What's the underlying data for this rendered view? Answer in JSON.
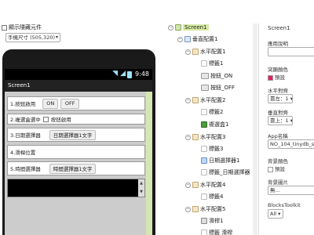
{
  "viewer": {
    "show_hidden_label": "顯示隱藏元件",
    "phone_size": "手機尺寸 (505,320)",
    "status_time": "9:48",
    "screen_title": "Screen1",
    "rows": [
      {
        "label": "1.按鈕啟用",
        "buttons": [
          "ON",
          "OFF"
        ]
      },
      {
        "label": "2.複選盒選中",
        "checkbox_label": "按鈕啟用"
      },
      {
        "label": "3.日期選擇器",
        "picker": "日期選擇器1文字"
      },
      {
        "label": "4.滑桿位置"
      },
      {
        "label": "5.時間選擇器",
        "picker": "時間選擇器1文字"
      }
    ]
  },
  "tree": {
    "nodes": [
      {
        "label": "Screen1",
        "icon": "screen"
      },
      {
        "label": "垂直配置1",
        "icon": "vert"
      },
      {
        "label": "水平配置1",
        "icon": "horz"
      },
      {
        "label": "標籤1",
        "icon": "label"
      },
      {
        "label": "按鈕_ON",
        "icon": "btn"
      },
      {
        "label": "按鈕_OFF",
        "icon": "btn"
      },
      {
        "label": "水平配置2",
        "icon": "horz"
      },
      {
        "label": "標籤2",
        "icon": "label"
      },
      {
        "label": "複選盒1",
        "icon": "check"
      },
      {
        "label": "水平配置3",
        "icon": "horz"
      },
      {
        "label": "標籤3",
        "icon": "label"
      },
      {
        "label": "日期選擇器1",
        "icon": "date"
      },
      {
        "label": "標籤_日期選擇器",
        "icon": "label"
      },
      {
        "label": "水平配置4",
        "icon": "horz"
      },
      {
        "label": "標籤4",
        "icon": "label"
      },
      {
        "label": "水平配置5",
        "icon": "horz"
      },
      {
        "label": "滑桿1",
        "icon": "slider"
      },
      {
        "label": "標籤 滑桿",
        "icon": "label"
      }
    ]
  },
  "props": {
    "title": "Screen1",
    "about_label": "應用說明",
    "about_value": "",
    "accent_label": "突顯顏色",
    "accent_value": "預設",
    "accent_color": "#e91e63",
    "halign_label": "水平對齊",
    "halign_value": "靠左：1",
    "valign_label": "垂直對齊",
    "valign_value": "靠上：1",
    "appname_label": "App名稱",
    "appname_value": "NO_104_tinydb_sa",
    "bgcolor_label": "背景顏色",
    "bgcolor_value": "預設",
    "bgcolor_color": "#ffffff",
    "bgimage_label": "背景圖片",
    "bgimage_value": "無...",
    "blocks_label": "BlocksToolkit",
    "blocks_value": "All"
  }
}
